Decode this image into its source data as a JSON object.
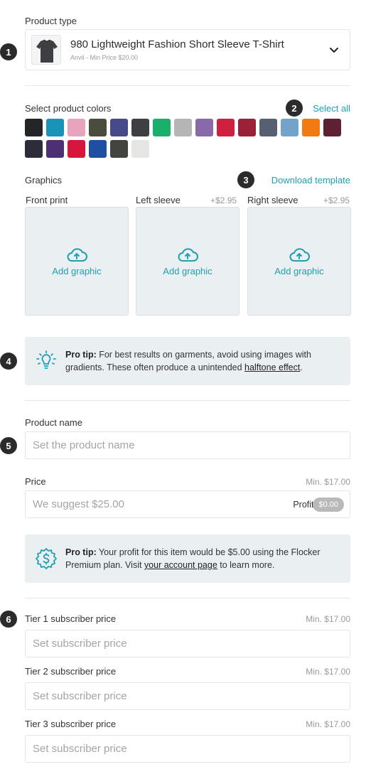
{
  "product_type": {
    "label": "Product type",
    "name": "980 Lightweight Fashion Short Sleeve T-Shirt",
    "sub": "Anvil - Min Price $20.00"
  },
  "badges": [
    "1",
    "2",
    "3",
    "4",
    "5",
    "6"
  ],
  "colors": {
    "label": "Select product colors",
    "select_all": "Select all",
    "swatches": [
      "#232528",
      "#1a93b8",
      "#e7a5bd",
      "#4a4d3c",
      "#474a8a",
      "#3e3f41",
      "#1ab06b",
      "#b5b5b5",
      "#8a69a8",
      "#d0203f",
      "#9a2237",
      "#566072",
      "#73a3cb",
      "#f27a13",
      "#5e2134",
      "#2b2d3b",
      "#4d2f73",
      "#d7163e",
      "#1e4fa0",
      "#434340",
      "#e5e5e3"
    ]
  },
  "graphics": {
    "label": "Graphics",
    "download": "Download template",
    "columns": [
      {
        "label": "Front print",
        "price": "",
        "action": "Add graphic"
      },
      {
        "label": "Left sleeve",
        "price": "+$2.95",
        "action": "Add graphic"
      },
      {
        "label": "Right sleeve",
        "price": "+$2.95",
        "action": "Add graphic"
      }
    ]
  },
  "tip1": {
    "strong": "Pro tip:",
    "text": " For best results on garments, avoid using images with gradients. These often produce a unintended ",
    "link": "halftone effect",
    "end": "."
  },
  "product_name": {
    "label": "Product name",
    "placeholder": "Set the product name"
  },
  "price": {
    "label": "Price",
    "min": "Min. $17.00",
    "placeholder": "We suggest $25.00",
    "profit_label": "Profit:",
    "profit_value": "$0.00"
  },
  "tip2": {
    "strong": "Pro tip:",
    "text": " Your profit for this item would be $5.00 using the Flocker Premium plan. Visit ",
    "link": "your account page",
    "end": " to learn more."
  },
  "tiers": [
    {
      "label": "Tier 1 subscriber price",
      "min": "Min. $17.00",
      "placeholder": "Set subscriber price"
    },
    {
      "label": "Tier 2 subscriber price",
      "min": "Min. $17.00",
      "placeholder": "Set subscriber price"
    },
    {
      "label": "Tier 3 subscriber price",
      "min": "Min. $17.00",
      "placeholder": "Set subscriber price"
    }
  ]
}
